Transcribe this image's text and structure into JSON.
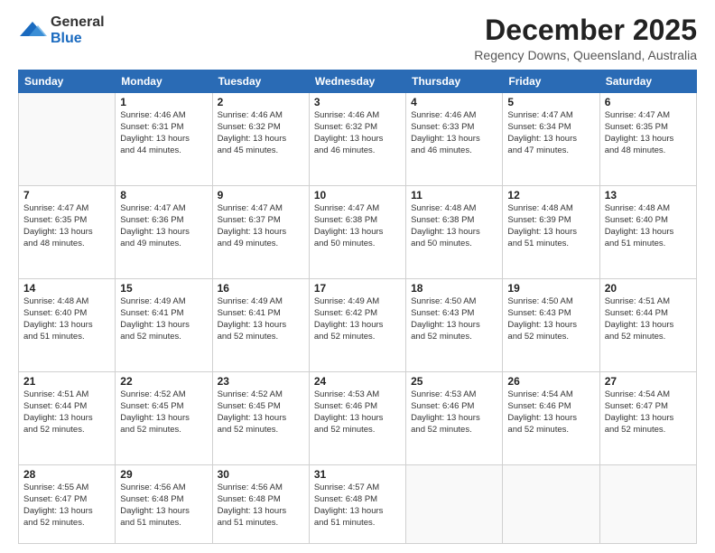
{
  "logo": {
    "general": "General",
    "blue": "Blue"
  },
  "header": {
    "month": "December 2025",
    "location": "Regency Downs, Queensland, Australia"
  },
  "weekdays": [
    "Sunday",
    "Monday",
    "Tuesday",
    "Wednesday",
    "Thursday",
    "Friday",
    "Saturday"
  ],
  "weeks": [
    [
      {
        "day": "",
        "info": ""
      },
      {
        "day": "1",
        "info": "Sunrise: 4:46 AM\nSunset: 6:31 PM\nDaylight: 13 hours\nand 44 minutes."
      },
      {
        "day": "2",
        "info": "Sunrise: 4:46 AM\nSunset: 6:32 PM\nDaylight: 13 hours\nand 45 minutes."
      },
      {
        "day": "3",
        "info": "Sunrise: 4:46 AM\nSunset: 6:32 PM\nDaylight: 13 hours\nand 46 minutes."
      },
      {
        "day": "4",
        "info": "Sunrise: 4:46 AM\nSunset: 6:33 PM\nDaylight: 13 hours\nand 46 minutes."
      },
      {
        "day": "5",
        "info": "Sunrise: 4:47 AM\nSunset: 6:34 PM\nDaylight: 13 hours\nand 47 minutes."
      },
      {
        "day": "6",
        "info": "Sunrise: 4:47 AM\nSunset: 6:35 PM\nDaylight: 13 hours\nand 48 minutes."
      }
    ],
    [
      {
        "day": "7",
        "info": "Sunrise: 4:47 AM\nSunset: 6:35 PM\nDaylight: 13 hours\nand 48 minutes."
      },
      {
        "day": "8",
        "info": "Sunrise: 4:47 AM\nSunset: 6:36 PM\nDaylight: 13 hours\nand 49 minutes."
      },
      {
        "day": "9",
        "info": "Sunrise: 4:47 AM\nSunset: 6:37 PM\nDaylight: 13 hours\nand 49 minutes."
      },
      {
        "day": "10",
        "info": "Sunrise: 4:47 AM\nSunset: 6:38 PM\nDaylight: 13 hours\nand 50 minutes."
      },
      {
        "day": "11",
        "info": "Sunrise: 4:48 AM\nSunset: 6:38 PM\nDaylight: 13 hours\nand 50 minutes."
      },
      {
        "day": "12",
        "info": "Sunrise: 4:48 AM\nSunset: 6:39 PM\nDaylight: 13 hours\nand 51 minutes."
      },
      {
        "day": "13",
        "info": "Sunrise: 4:48 AM\nSunset: 6:40 PM\nDaylight: 13 hours\nand 51 minutes."
      }
    ],
    [
      {
        "day": "14",
        "info": "Sunrise: 4:48 AM\nSunset: 6:40 PM\nDaylight: 13 hours\nand 51 minutes."
      },
      {
        "day": "15",
        "info": "Sunrise: 4:49 AM\nSunset: 6:41 PM\nDaylight: 13 hours\nand 52 minutes."
      },
      {
        "day": "16",
        "info": "Sunrise: 4:49 AM\nSunset: 6:41 PM\nDaylight: 13 hours\nand 52 minutes."
      },
      {
        "day": "17",
        "info": "Sunrise: 4:49 AM\nSunset: 6:42 PM\nDaylight: 13 hours\nand 52 minutes."
      },
      {
        "day": "18",
        "info": "Sunrise: 4:50 AM\nSunset: 6:43 PM\nDaylight: 13 hours\nand 52 minutes."
      },
      {
        "day": "19",
        "info": "Sunrise: 4:50 AM\nSunset: 6:43 PM\nDaylight: 13 hours\nand 52 minutes."
      },
      {
        "day": "20",
        "info": "Sunrise: 4:51 AM\nSunset: 6:44 PM\nDaylight: 13 hours\nand 52 minutes."
      }
    ],
    [
      {
        "day": "21",
        "info": "Sunrise: 4:51 AM\nSunset: 6:44 PM\nDaylight: 13 hours\nand 52 minutes."
      },
      {
        "day": "22",
        "info": "Sunrise: 4:52 AM\nSunset: 6:45 PM\nDaylight: 13 hours\nand 52 minutes."
      },
      {
        "day": "23",
        "info": "Sunrise: 4:52 AM\nSunset: 6:45 PM\nDaylight: 13 hours\nand 52 minutes."
      },
      {
        "day": "24",
        "info": "Sunrise: 4:53 AM\nSunset: 6:46 PM\nDaylight: 13 hours\nand 52 minutes."
      },
      {
        "day": "25",
        "info": "Sunrise: 4:53 AM\nSunset: 6:46 PM\nDaylight: 13 hours\nand 52 minutes."
      },
      {
        "day": "26",
        "info": "Sunrise: 4:54 AM\nSunset: 6:46 PM\nDaylight: 13 hours\nand 52 minutes."
      },
      {
        "day": "27",
        "info": "Sunrise: 4:54 AM\nSunset: 6:47 PM\nDaylight: 13 hours\nand 52 minutes."
      }
    ],
    [
      {
        "day": "28",
        "info": "Sunrise: 4:55 AM\nSunset: 6:47 PM\nDaylight: 13 hours\nand 52 minutes."
      },
      {
        "day": "29",
        "info": "Sunrise: 4:56 AM\nSunset: 6:48 PM\nDaylight: 13 hours\nand 51 minutes."
      },
      {
        "day": "30",
        "info": "Sunrise: 4:56 AM\nSunset: 6:48 PM\nDaylight: 13 hours\nand 51 minutes."
      },
      {
        "day": "31",
        "info": "Sunrise: 4:57 AM\nSunset: 6:48 PM\nDaylight: 13 hours\nand 51 minutes."
      },
      {
        "day": "",
        "info": ""
      },
      {
        "day": "",
        "info": ""
      },
      {
        "day": "",
        "info": ""
      }
    ]
  ]
}
